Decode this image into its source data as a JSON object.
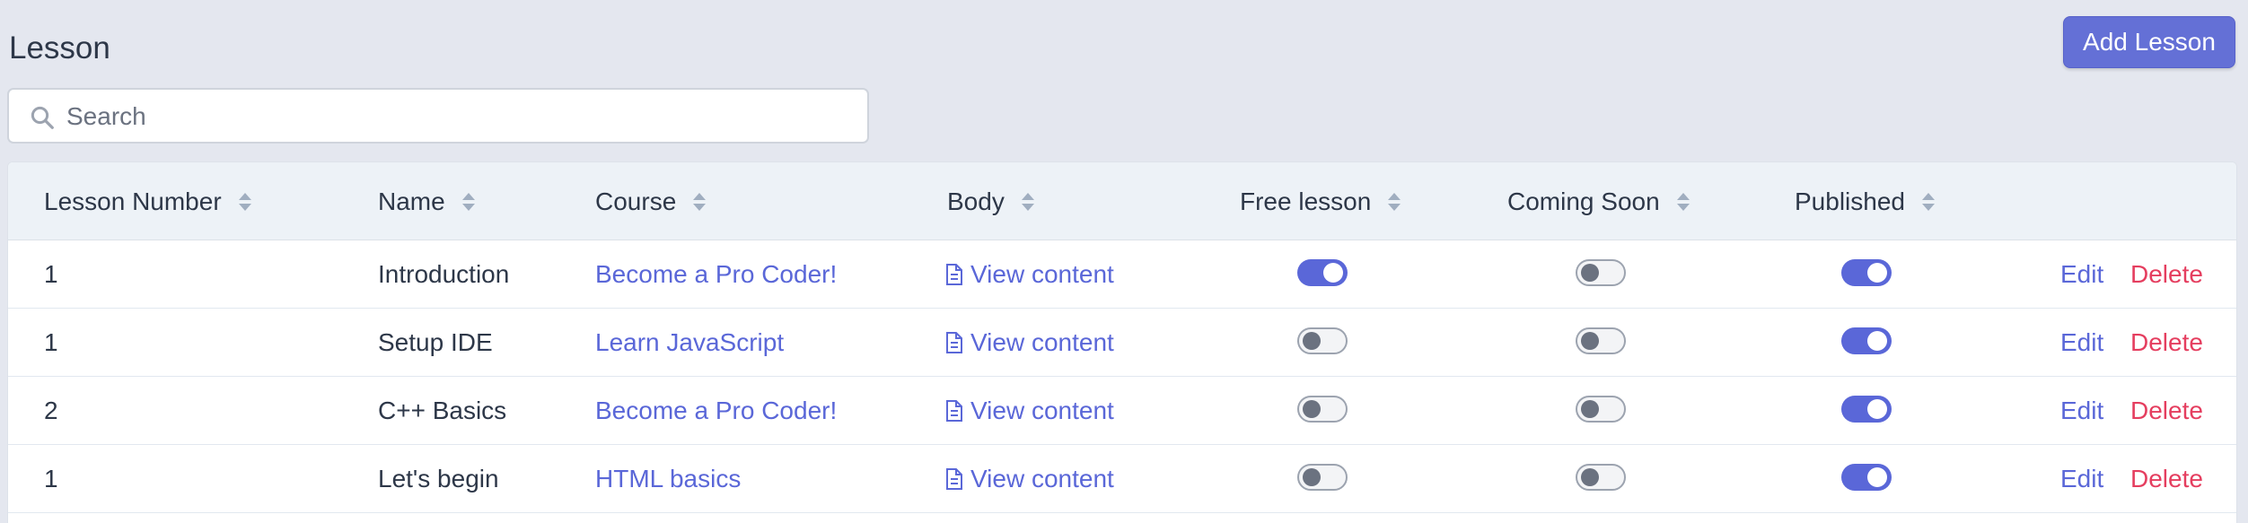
{
  "page": {
    "title": "Lesson"
  },
  "toolbar": {
    "add_label": "Add Lesson"
  },
  "search": {
    "placeholder": "Search",
    "value": ""
  },
  "table": {
    "headers": {
      "lesson_number": "Lesson Number",
      "name": "Name",
      "course": "Course",
      "body": "Body",
      "free_lesson": "Free lesson",
      "coming_soon": "Coming Soon",
      "published": "Published"
    },
    "rows": [
      {
        "lesson_number": "1",
        "name": "Introduction",
        "course": "Become a Pro Coder!",
        "body": "View content",
        "free_lesson": true,
        "coming_soon": false,
        "published": true,
        "edit": "Edit",
        "delete": "Delete"
      },
      {
        "lesson_number": "1",
        "name": "Setup IDE",
        "course": "Learn JavaScript",
        "body": "View content",
        "free_lesson": false,
        "coming_soon": false,
        "published": true,
        "edit": "Edit",
        "delete": "Delete"
      },
      {
        "lesson_number": "2",
        "name": "C++ Basics",
        "course": "Become a Pro Coder!",
        "body": "View content",
        "free_lesson": false,
        "coming_soon": false,
        "published": true,
        "edit": "Edit",
        "delete": "Delete"
      },
      {
        "lesson_number": "1",
        "name": "Let's begin",
        "course": "HTML basics",
        "body": "View content",
        "free_lesson": false,
        "coming_soon": false,
        "published": true,
        "edit": "Edit",
        "delete": "Delete"
      }
    ]
  },
  "icons": {
    "search": "search-icon",
    "sort": "sort-icon",
    "document": "document-icon"
  },
  "colors": {
    "accent": "#5a67d8",
    "danger": "#e53e5f",
    "background": "#e4e7ef"
  }
}
